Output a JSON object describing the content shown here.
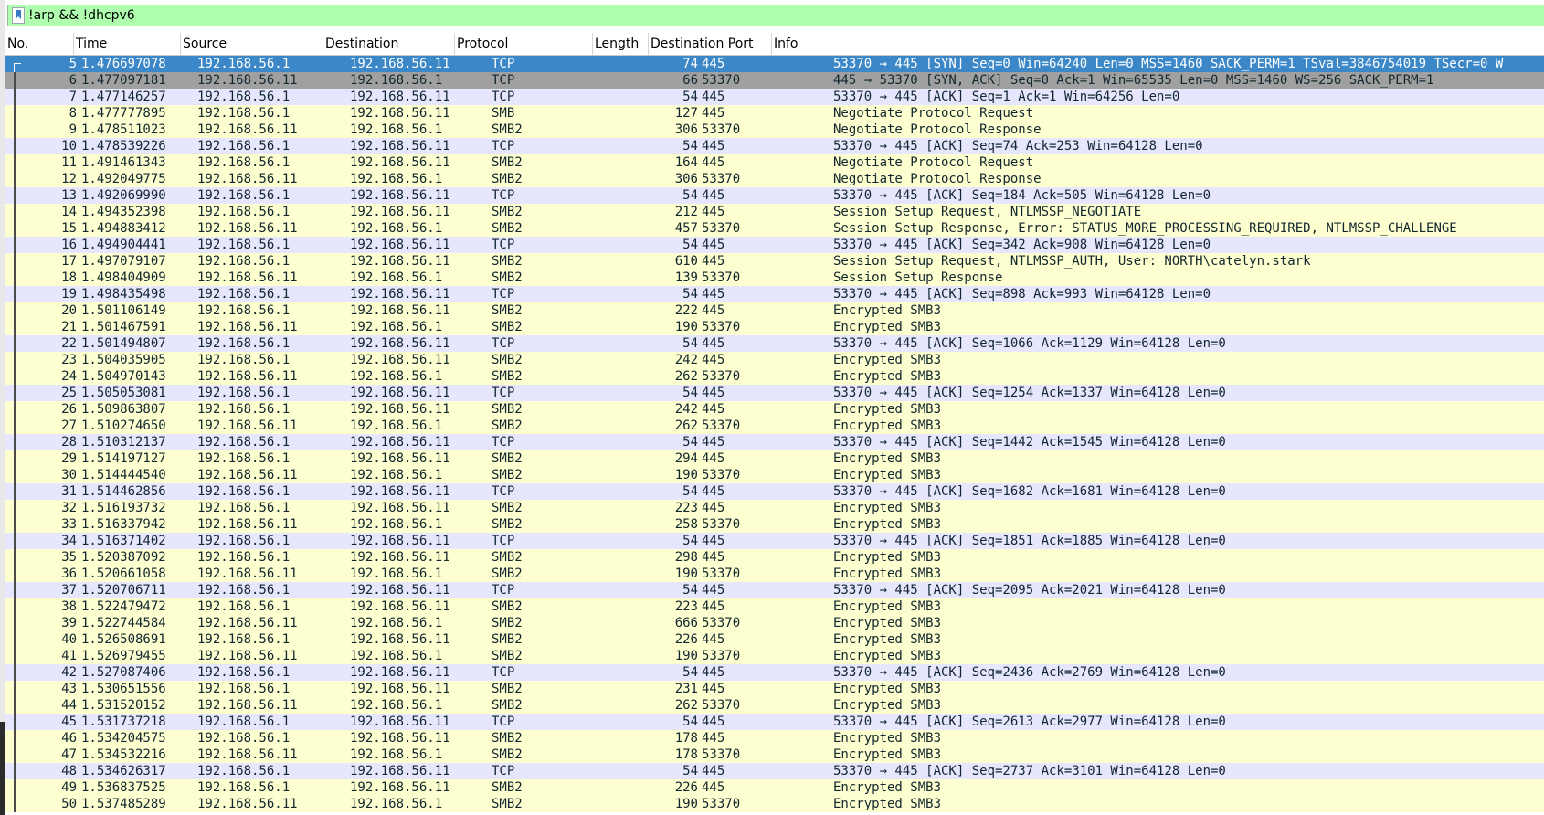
{
  "filter": {
    "text": "!arp && !dhcpv6"
  },
  "columns": [
    {
      "label": "No."
    },
    {
      "label": "Time"
    },
    {
      "label": "Source"
    },
    {
      "label": "Destination"
    },
    {
      "label": "Protocol"
    },
    {
      "label": "Length"
    },
    {
      "label": "Destination Port"
    },
    {
      "label": "Info"
    }
  ],
  "colors": {
    "selected": "#3b87c8",
    "tcp_row": "#e7e6ff",
    "smb_row": "#feffd0",
    "filter_ok": "#afffaf"
  },
  "packets": [
    {
      "no": "5",
      "time": "1.476697078",
      "src": "192.168.56.1",
      "dst": "192.168.56.11",
      "proto": "TCP",
      "len": "74",
      "dport": "445",
      "info": "53370 → 445 [SYN] Seq=0 Win=64240 Len=0 MSS=1460 SACK_PERM=1 TSval=3846754019 TSecr=0 W",
      "style": "sel"
    },
    {
      "no": "6",
      "time": "1.477097181",
      "src": "192.168.56.11",
      "dst": "192.168.56.1",
      "proto": "TCP",
      "len": "66",
      "dport": "53370",
      "info": "445 → 53370 [SYN, ACK] Seq=0 Ack=1 Win=65535 Len=0 MSS=1460 WS=256 SACK_PERM=1",
      "style": "rel"
    },
    {
      "no": "7",
      "time": "1.477146257",
      "src": "192.168.56.1",
      "dst": "192.168.56.11",
      "proto": "TCP",
      "len": "54",
      "dport": "445",
      "info": "53370 → 445 [ACK] Seq=1 Ack=1 Win=64256 Len=0",
      "style": "tcp"
    },
    {
      "no": "8",
      "time": "1.477777895",
      "src": "192.168.56.1",
      "dst": "192.168.56.11",
      "proto": "SMB",
      "len": "127",
      "dport": "445",
      "info": "Negotiate Protocol Request",
      "style": "smb"
    },
    {
      "no": "9",
      "time": "1.478511023",
      "src": "192.168.56.11",
      "dst": "192.168.56.1",
      "proto": "SMB2",
      "len": "306",
      "dport": "53370",
      "info": "Negotiate Protocol Response",
      "style": "smb"
    },
    {
      "no": "10",
      "time": "1.478539226",
      "src": "192.168.56.1",
      "dst": "192.168.56.11",
      "proto": "TCP",
      "len": "54",
      "dport": "445",
      "info": "53370 → 445 [ACK] Seq=74 Ack=253 Win=64128 Len=0",
      "style": "tcp"
    },
    {
      "no": "11",
      "time": "1.491461343",
      "src": "192.168.56.1",
      "dst": "192.168.56.11",
      "proto": "SMB2",
      "len": "164",
      "dport": "445",
      "info": "Negotiate Protocol Request",
      "style": "smb"
    },
    {
      "no": "12",
      "time": "1.492049775",
      "src": "192.168.56.11",
      "dst": "192.168.56.1",
      "proto": "SMB2",
      "len": "306",
      "dport": "53370",
      "info": "Negotiate Protocol Response",
      "style": "smb"
    },
    {
      "no": "13",
      "time": "1.492069990",
      "src": "192.168.56.1",
      "dst": "192.168.56.11",
      "proto": "TCP",
      "len": "54",
      "dport": "445",
      "info": "53370 → 445 [ACK] Seq=184 Ack=505 Win=64128 Len=0",
      "style": "tcp"
    },
    {
      "no": "14",
      "time": "1.494352398",
      "src": "192.168.56.1",
      "dst": "192.168.56.11",
      "proto": "SMB2",
      "len": "212",
      "dport": "445",
      "info": "Session Setup Request, NTLMSSP_NEGOTIATE",
      "style": "smb"
    },
    {
      "no": "15",
      "time": "1.494883412",
      "src": "192.168.56.11",
      "dst": "192.168.56.1",
      "proto": "SMB2",
      "len": "457",
      "dport": "53370",
      "info": "Session Setup Response, Error: STATUS_MORE_PROCESSING_REQUIRED, NTLMSSP_CHALLENGE",
      "style": "smb"
    },
    {
      "no": "16",
      "time": "1.494904441",
      "src": "192.168.56.1",
      "dst": "192.168.56.11",
      "proto": "TCP",
      "len": "54",
      "dport": "445",
      "info": "53370 → 445 [ACK] Seq=342 Ack=908 Win=64128 Len=0",
      "style": "tcp"
    },
    {
      "no": "17",
      "time": "1.497079107",
      "src": "192.168.56.1",
      "dst": "192.168.56.11",
      "proto": "SMB2",
      "len": "610",
      "dport": "445",
      "info": "Session Setup Request, NTLMSSP_AUTH, User: NORTH\\catelyn.stark",
      "style": "smb"
    },
    {
      "no": "18",
      "time": "1.498404909",
      "src": "192.168.56.11",
      "dst": "192.168.56.1",
      "proto": "SMB2",
      "len": "139",
      "dport": "53370",
      "info": "Session Setup Response",
      "style": "smb"
    },
    {
      "no": "19",
      "time": "1.498435498",
      "src": "192.168.56.1",
      "dst": "192.168.56.11",
      "proto": "TCP",
      "len": "54",
      "dport": "445",
      "info": "53370 → 445 [ACK] Seq=898 Ack=993 Win=64128 Len=0",
      "style": "tcp"
    },
    {
      "no": "20",
      "time": "1.501106149",
      "src": "192.168.56.1",
      "dst": "192.168.56.11",
      "proto": "SMB2",
      "len": "222",
      "dport": "445",
      "info": "Encrypted SMB3",
      "style": "smb"
    },
    {
      "no": "21",
      "time": "1.501467591",
      "src": "192.168.56.11",
      "dst": "192.168.56.1",
      "proto": "SMB2",
      "len": "190",
      "dport": "53370",
      "info": "Encrypted SMB3",
      "style": "smb"
    },
    {
      "no": "22",
      "time": "1.501494807",
      "src": "192.168.56.1",
      "dst": "192.168.56.11",
      "proto": "TCP",
      "len": "54",
      "dport": "445",
      "info": "53370 → 445 [ACK] Seq=1066 Ack=1129 Win=64128 Len=0",
      "style": "tcp"
    },
    {
      "no": "23",
      "time": "1.504035905",
      "src": "192.168.56.1",
      "dst": "192.168.56.11",
      "proto": "SMB2",
      "len": "242",
      "dport": "445",
      "info": "Encrypted SMB3",
      "style": "smb"
    },
    {
      "no": "24",
      "time": "1.504970143",
      "src": "192.168.56.11",
      "dst": "192.168.56.1",
      "proto": "SMB2",
      "len": "262",
      "dport": "53370",
      "info": "Encrypted SMB3",
      "style": "smb"
    },
    {
      "no": "25",
      "time": "1.505053081",
      "src": "192.168.56.1",
      "dst": "192.168.56.11",
      "proto": "TCP",
      "len": "54",
      "dport": "445",
      "info": "53370 → 445 [ACK] Seq=1254 Ack=1337 Win=64128 Len=0",
      "style": "tcp"
    },
    {
      "no": "26",
      "time": "1.509863807",
      "src": "192.168.56.1",
      "dst": "192.168.56.11",
      "proto": "SMB2",
      "len": "242",
      "dport": "445",
      "info": "Encrypted SMB3",
      "style": "smb"
    },
    {
      "no": "27",
      "time": "1.510274650",
      "src": "192.168.56.11",
      "dst": "192.168.56.1",
      "proto": "SMB2",
      "len": "262",
      "dport": "53370",
      "info": "Encrypted SMB3",
      "style": "smb"
    },
    {
      "no": "28",
      "time": "1.510312137",
      "src": "192.168.56.1",
      "dst": "192.168.56.11",
      "proto": "TCP",
      "len": "54",
      "dport": "445",
      "info": "53370 → 445 [ACK] Seq=1442 Ack=1545 Win=64128 Len=0",
      "style": "tcp"
    },
    {
      "no": "29",
      "time": "1.514197127",
      "src": "192.168.56.1",
      "dst": "192.168.56.11",
      "proto": "SMB2",
      "len": "294",
      "dport": "445",
      "info": "Encrypted SMB3",
      "style": "smb"
    },
    {
      "no": "30",
      "time": "1.514444540",
      "src": "192.168.56.11",
      "dst": "192.168.56.1",
      "proto": "SMB2",
      "len": "190",
      "dport": "53370",
      "info": "Encrypted SMB3",
      "style": "smb"
    },
    {
      "no": "31",
      "time": "1.514462856",
      "src": "192.168.56.1",
      "dst": "192.168.56.11",
      "proto": "TCP",
      "len": "54",
      "dport": "445",
      "info": "53370 → 445 [ACK] Seq=1682 Ack=1681 Win=64128 Len=0",
      "style": "tcp"
    },
    {
      "no": "32",
      "time": "1.516193732",
      "src": "192.168.56.1",
      "dst": "192.168.56.11",
      "proto": "SMB2",
      "len": "223",
      "dport": "445",
      "info": "Encrypted SMB3",
      "style": "smb"
    },
    {
      "no": "33",
      "time": "1.516337942",
      "src": "192.168.56.11",
      "dst": "192.168.56.1",
      "proto": "SMB2",
      "len": "258",
      "dport": "53370",
      "info": "Encrypted SMB3",
      "style": "smb"
    },
    {
      "no": "34",
      "time": "1.516371402",
      "src": "192.168.56.1",
      "dst": "192.168.56.11",
      "proto": "TCP",
      "len": "54",
      "dport": "445",
      "info": "53370 → 445 [ACK] Seq=1851 Ack=1885 Win=64128 Len=0",
      "style": "tcp"
    },
    {
      "no": "35",
      "time": "1.520387092",
      "src": "192.168.56.1",
      "dst": "192.168.56.11",
      "proto": "SMB2",
      "len": "298",
      "dport": "445",
      "info": "Encrypted SMB3",
      "style": "smb"
    },
    {
      "no": "36",
      "time": "1.520661058",
      "src": "192.168.56.11",
      "dst": "192.168.56.1",
      "proto": "SMB2",
      "len": "190",
      "dport": "53370",
      "info": "Encrypted SMB3",
      "style": "smb"
    },
    {
      "no": "37",
      "time": "1.520706711",
      "src": "192.168.56.1",
      "dst": "192.168.56.11",
      "proto": "TCP",
      "len": "54",
      "dport": "445",
      "info": "53370 → 445 [ACK] Seq=2095 Ack=2021 Win=64128 Len=0",
      "style": "tcp"
    },
    {
      "no": "38",
      "time": "1.522479472",
      "src": "192.168.56.1",
      "dst": "192.168.56.11",
      "proto": "SMB2",
      "len": "223",
      "dport": "445",
      "info": "Encrypted SMB3",
      "style": "smb"
    },
    {
      "no": "39",
      "time": "1.522744584",
      "src": "192.168.56.11",
      "dst": "192.168.56.1",
      "proto": "SMB2",
      "len": "666",
      "dport": "53370",
      "info": "Encrypted SMB3",
      "style": "smb"
    },
    {
      "no": "40",
      "time": "1.526508691",
      "src": "192.168.56.1",
      "dst": "192.168.56.11",
      "proto": "SMB2",
      "len": "226",
      "dport": "445",
      "info": "Encrypted SMB3",
      "style": "smb"
    },
    {
      "no": "41",
      "time": "1.526979455",
      "src": "192.168.56.11",
      "dst": "192.168.56.1",
      "proto": "SMB2",
      "len": "190",
      "dport": "53370",
      "info": "Encrypted SMB3",
      "style": "smb"
    },
    {
      "no": "42",
      "time": "1.527087406",
      "src": "192.168.56.1",
      "dst": "192.168.56.11",
      "proto": "TCP",
      "len": "54",
      "dport": "445",
      "info": "53370 → 445 [ACK] Seq=2436 Ack=2769 Win=64128 Len=0",
      "style": "tcp"
    },
    {
      "no": "43",
      "time": "1.530651556",
      "src": "192.168.56.1",
      "dst": "192.168.56.11",
      "proto": "SMB2",
      "len": "231",
      "dport": "445",
      "info": "Encrypted SMB3",
      "style": "smb"
    },
    {
      "no": "44",
      "time": "1.531520152",
      "src": "192.168.56.11",
      "dst": "192.168.56.1",
      "proto": "SMB2",
      "len": "262",
      "dport": "53370",
      "info": "Encrypted SMB3",
      "style": "smb"
    },
    {
      "no": "45",
      "time": "1.531737218",
      "src": "192.168.56.1",
      "dst": "192.168.56.11",
      "proto": "TCP",
      "len": "54",
      "dport": "445",
      "info": "53370 → 445 [ACK] Seq=2613 Ack=2977 Win=64128 Len=0",
      "style": "tcp"
    },
    {
      "no": "46",
      "time": "1.534204575",
      "src": "192.168.56.1",
      "dst": "192.168.56.11",
      "proto": "SMB2",
      "len": "178",
      "dport": "445",
      "info": "Encrypted SMB3",
      "style": "smb"
    },
    {
      "no": "47",
      "time": "1.534532216",
      "src": "192.168.56.11",
      "dst": "192.168.56.1",
      "proto": "SMB2",
      "len": "178",
      "dport": "53370",
      "info": "Encrypted SMB3",
      "style": "smb"
    },
    {
      "no": "48",
      "time": "1.534626317",
      "src": "192.168.56.1",
      "dst": "192.168.56.11",
      "proto": "TCP",
      "len": "54",
      "dport": "445",
      "info": "53370 → 445 [ACK] Seq=2737 Ack=3101 Win=64128 Len=0",
      "style": "tcp"
    },
    {
      "no": "49",
      "time": "1.536837525",
      "src": "192.168.56.1",
      "dst": "192.168.56.11",
      "proto": "SMB2",
      "len": "226",
      "dport": "445",
      "info": "Encrypted SMB3",
      "style": "smb"
    },
    {
      "no": "50",
      "time": "1.537485289",
      "src": "192.168.56.11",
      "dst": "192.168.56.1",
      "proto": "SMB2",
      "len": "190",
      "dport": "53370",
      "info": "Encrypted SMB3",
      "style": "smb"
    }
  ]
}
